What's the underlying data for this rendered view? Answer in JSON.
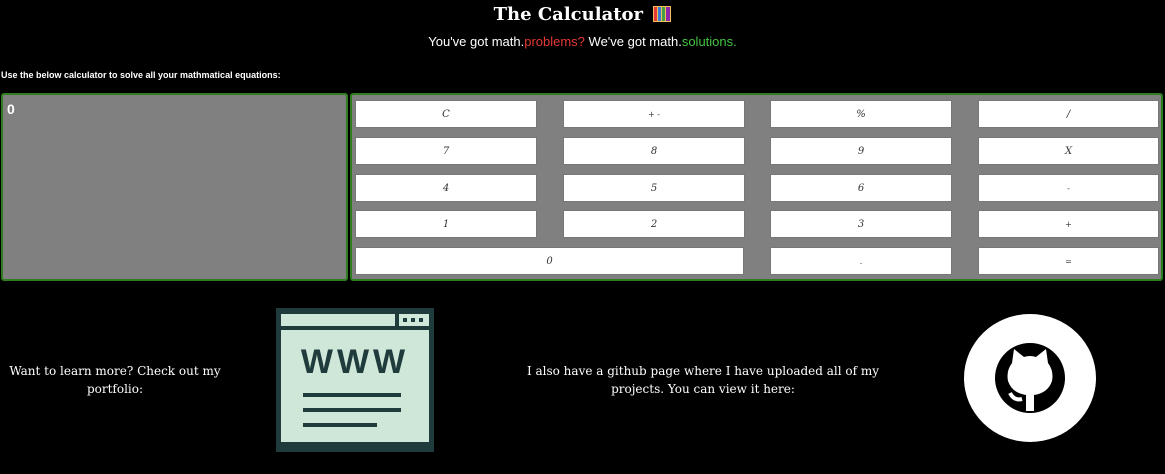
{
  "header": {
    "title": "The Calculator",
    "tagline_a": "You've got math.",
    "tagline_b": "problems?",
    "tagline_c": " We've got math.",
    "tagline_d": "solutions."
  },
  "instructions": "Use the below calculator to solve all your mathmatical equations:",
  "display": {
    "value": "0"
  },
  "keys": {
    "clear": "C",
    "plusminus": "+ -",
    "percent": "%",
    "divide": "/",
    "seven": "7",
    "eight": "8",
    "nine": "9",
    "multiply": "X",
    "four": "4",
    "five": "5",
    "six": "6",
    "minus": "-",
    "one": "1",
    "two": "2",
    "three": "3",
    "plus": "+",
    "zero": "0",
    "decimal": ".",
    "equals": "="
  },
  "footer": {
    "portfolio_text": "Want to learn more? Check out my portfolio:",
    "github_text": "I also have a github page where I have uploaded all of my projects. You can view it here:",
    "www_label": "WWW"
  },
  "colors": {
    "background": "#000000",
    "panel": "#808080",
    "panel_border": "#2e7d1f",
    "problems": "#e53935",
    "solutions": "#43c443",
    "www_fill": "#cfe7d9",
    "www_stroke": "#1f3b3b"
  },
  "icons": {
    "title": "books-icon",
    "portfolio": "www-browser-icon",
    "github": "github-octocat-icon"
  }
}
